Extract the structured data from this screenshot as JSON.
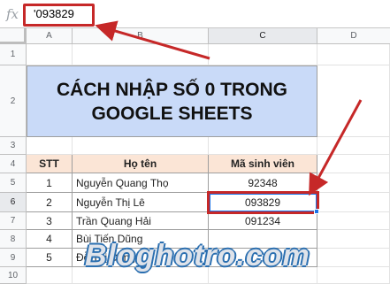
{
  "formula_bar": {
    "fx_label": "fx",
    "value": "'093829"
  },
  "columns": [
    "A",
    "B",
    "C",
    "D"
  ],
  "rows": [
    "1",
    "2",
    "3",
    "4",
    "5",
    "6",
    "7",
    "8",
    "9",
    "10"
  ],
  "title": {
    "line1": "CÁCH NHẬP SỐ 0 TRONG",
    "line2": "GOOGLE SHEETS"
  },
  "table": {
    "headers": [
      "STT",
      "Họ tên",
      "Mã sinh viên"
    ],
    "rows": [
      {
        "stt": "1",
        "name": "Nguyễn Quang Thọ",
        "id": "92348"
      },
      {
        "stt": "2",
        "name": "Nguyễn Thị Lê",
        "id": "093829"
      },
      {
        "stt": "3",
        "name": "Trần Quang Hải",
        "id": "091234"
      },
      {
        "stt": "4",
        "name": "Bùi Tiến Dũng",
        "id": ""
      },
      {
        "stt": "5",
        "name": "Đỗ Thị Dung",
        "id": ""
      }
    ]
  },
  "watermark": "Bloghotro.com",
  "colors": {
    "highlight": "#c62828",
    "selection": "#1a73e8",
    "title_bg": "#c9daf8",
    "header_bg": "#fbe5d6"
  }
}
